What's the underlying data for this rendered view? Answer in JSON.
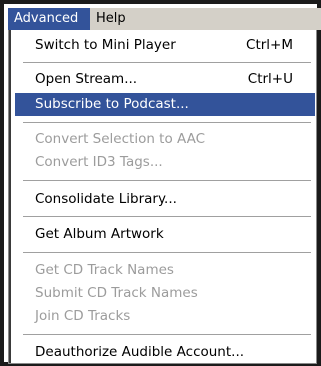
{
  "menubar": {
    "items": [
      {
        "label": "Advanced"
      },
      {
        "label": "Help"
      }
    ]
  },
  "menu": {
    "items": [
      {
        "label": "Switch to Mini Player",
        "shortcut": "Ctrl+M",
        "enabled": true
      },
      {
        "label": "Open Stream...",
        "shortcut": "Ctrl+U",
        "enabled": true
      },
      {
        "label": "Subscribe to Podcast...",
        "enabled": true,
        "highlighted": true
      },
      {
        "label": "Convert Selection to AAC",
        "enabled": false
      },
      {
        "label": "Convert ID3 Tags...",
        "enabled": false
      },
      {
        "label": "Consolidate Library...",
        "enabled": true
      },
      {
        "label": "Get Album Artwork",
        "enabled": true
      },
      {
        "label": "Get CD Track Names",
        "enabled": false
      },
      {
        "label": "Submit CD Track Names",
        "enabled": false
      },
      {
        "label": "Join CD Tracks",
        "enabled": false
      },
      {
        "label": "Deauthorize Audible Account...",
        "enabled": true
      }
    ]
  },
  "colors": {
    "highlight": "#33539a",
    "disabled_text": "#9c9c9c",
    "menubar_bg": "#d4d0c8"
  }
}
